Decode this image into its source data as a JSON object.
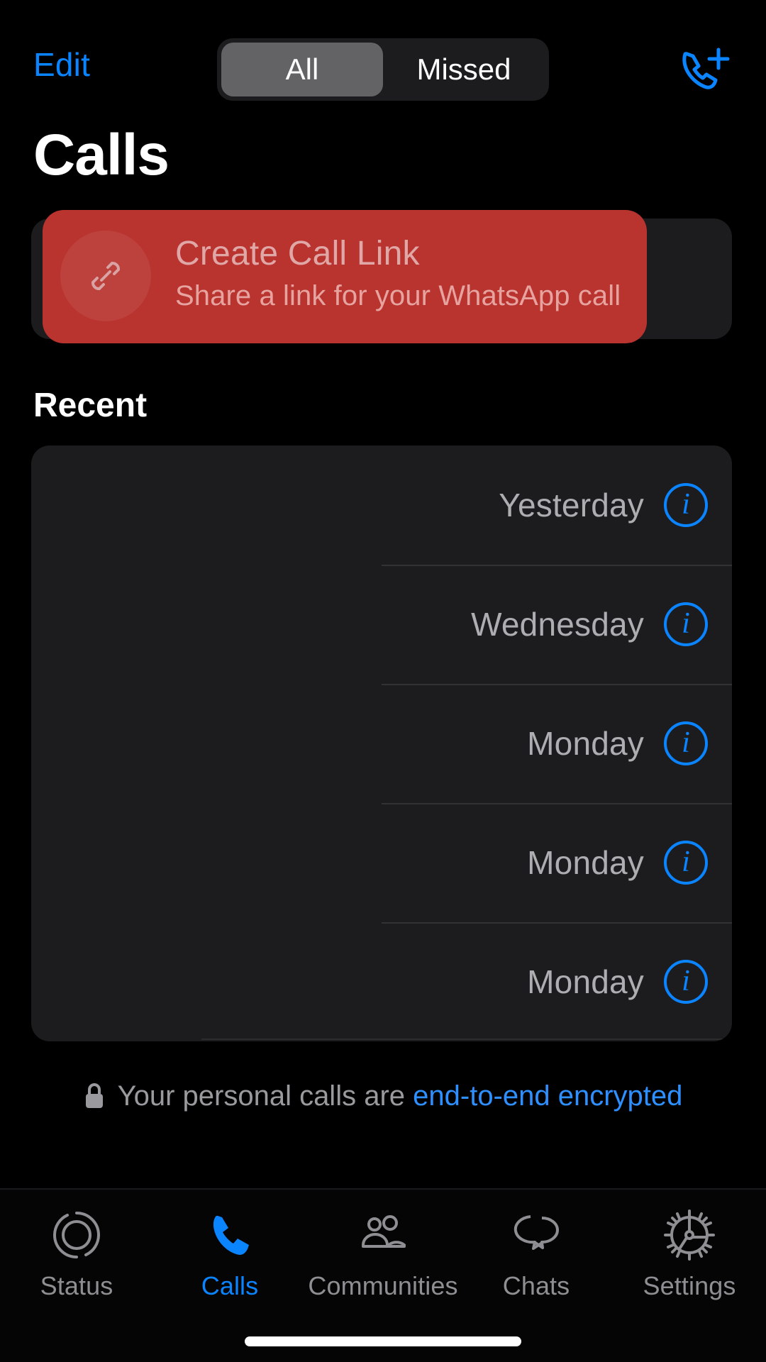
{
  "navbar": {
    "edit_label": "Edit",
    "segments": [
      {
        "label": "All",
        "selected": true
      },
      {
        "label": "Missed",
        "selected": false
      }
    ],
    "new_call_icon": "phone-plus-icon"
  },
  "page_title": "Calls",
  "call_link": {
    "icon": "link-icon",
    "title": "Create Call Link",
    "subtitle": "Share a link for your WhatsApp call",
    "highlight_color": "#b9332f",
    "card_color": "#1c1c1e"
  },
  "recent": {
    "header": "Recent",
    "rows": [
      {
        "date": "Yesterday",
        "info_icon": "info-circle-icon"
      },
      {
        "date": "Wednesday",
        "info_icon": "info-circle-icon"
      },
      {
        "date": "Monday",
        "info_icon": "info-circle-icon"
      },
      {
        "date": "Monday",
        "info_icon": "info-circle-icon"
      },
      {
        "date": "Monday",
        "info_icon": "info-circle-icon"
      }
    ]
  },
  "encryption_notice": {
    "icon": "lock-icon",
    "text": "Your personal calls are",
    "link_text": "end-to-end encrypted",
    "link_color": "#2e8fff"
  },
  "tabbar": {
    "accent_color": "#0a84ff",
    "inactive_color": "#8e8e93",
    "items": [
      {
        "label": "Status",
        "icon": "status-ring-icon",
        "active": false
      },
      {
        "label": "Calls",
        "icon": "phone-icon",
        "active": true
      },
      {
        "label": "Communities",
        "icon": "people-group-icon",
        "active": false
      },
      {
        "label": "Chats",
        "icon": "chat-bubbles-icon",
        "active": false
      },
      {
        "label": "Settings",
        "icon": "gear-icon",
        "active": false
      }
    ]
  }
}
